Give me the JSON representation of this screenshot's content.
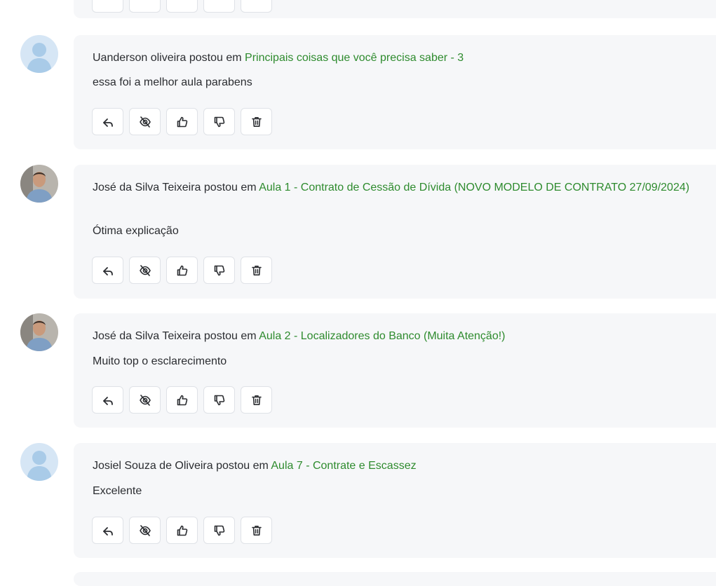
{
  "comments": [
    {
      "author": "Uanderson oliveira",
      "verb": "postou em",
      "lesson": "Principais coisas que você precisa saber - 3",
      "message": "essa foi a melhor aula parabens",
      "avatar": "default-avatar"
    },
    {
      "author": "José da Silva Teixeira",
      "verb": "postou em",
      "lesson": "Aula 1 - Contrato de Cessão de Dívida (NOVO MODELO DE CONTRATO 27/09/2024)",
      "message": "Ótima explicação",
      "avatar": "user-photo"
    },
    {
      "author": "José da Silva Teixeira",
      "verb": "postou em",
      "lesson": "Aula 2 - Localizadores do Banco (Muita Atenção!)",
      "message": "Muito top o esclarecimento",
      "avatar": "user-photo"
    },
    {
      "author": "Josiel Souza de Oliveira",
      "verb": "postou em",
      "lesson": "Aula 7 - Contrate e Escassez",
      "message": "Excelente",
      "avatar": "default-avatar"
    }
  ],
  "actions": [
    "reply-icon",
    "hide-icon",
    "thumbs-up-icon",
    "thumbs-down-icon",
    "trash-icon"
  ],
  "colors": {
    "link": "#2e8b2e",
    "card": "#f6f7f9",
    "text": "#2b2d31"
  }
}
